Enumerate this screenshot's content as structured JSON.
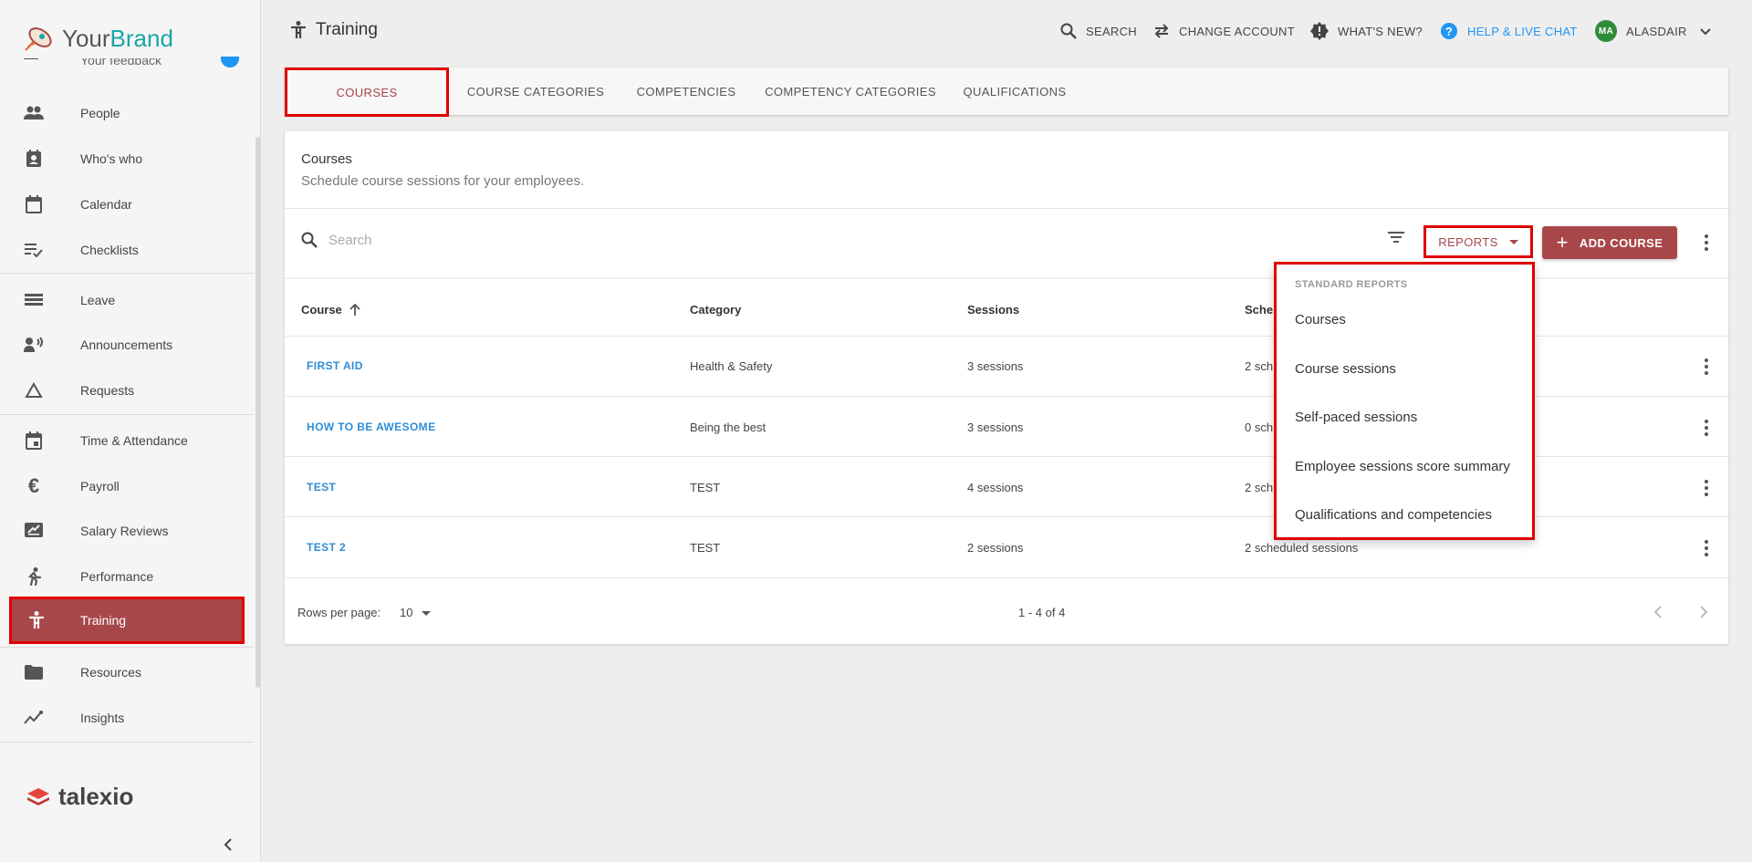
{
  "brand": {
    "name_part1": "Your",
    "name_part2": "Brand"
  },
  "sidebar": {
    "partial_item": "Your feedback",
    "items": [
      {
        "label": "People",
        "icon": "people-icon"
      },
      {
        "label": "Who's who",
        "icon": "contact-card-icon"
      },
      {
        "label": "Calendar",
        "icon": "calendar-icon"
      },
      {
        "label": "Checklists",
        "icon": "checklist-icon"
      },
      {
        "label": "Leave",
        "icon": "leave-icon"
      },
      {
        "label": "Announcements",
        "icon": "announcement-icon"
      },
      {
        "label": "Requests",
        "icon": "triangle-icon"
      },
      {
        "label": "Time & Attendance",
        "icon": "calendar-clock-icon"
      },
      {
        "label": "Payroll",
        "icon": "euro-icon"
      },
      {
        "label": "Salary Reviews",
        "icon": "salary-review-icon"
      },
      {
        "label": "Performance",
        "icon": "running-icon"
      },
      {
        "label": "Training",
        "icon": "person-icon"
      },
      {
        "label": "Resources",
        "icon": "folder-icon"
      },
      {
        "label": "Insights",
        "icon": "insights-icon"
      }
    ],
    "footer_brand": "talexio"
  },
  "header": {
    "title": "Training",
    "search": "SEARCH",
    "change_account": "CHANGE ACCOUNT",
    "whats_new": "WHAT'S NEW?",
    "help": "HELP & LIVE CHAT",
    "avatar_initials": "MA",
    "user": "ALASDAIR"
  },
  "tabs": [
    "COURSES",
    "COURSE CATEGORIES",
    "COMPETENCIES",
    "COMPETENCY CATEGORIES",
    "QUALIFICATIONS"
  ],
  "card": {
    "title": "Courses",
    "subtitle": "Schedule course sessions for your employees.",
    "search_placeholder": "Search",
    "reports_label": "REPORTS",
    "add_label": "ADD COURSE"
  },
  "table": {
    "headers": [
      "Course",
      "Category",
      "Sessions",
      "Sche"
    ],
    "rows": [
      {
        "course": "FIRST AID",
        "category": "Health & Safety",
        "sessions": "3 sessions",
        "scheduled": "2 sch"
      },
      {
        "course": "HOW TO BE AWESOME",
        "category": "Being the best",
        "sessions": "3 sessions",
        "scheduled": "0 sch"
      },
      {
        "course": "TEST",
        "category": "TEST",
        "sessions": "4 sessions",
        "scheduled": "2 sch"
      },
      {
        "course": "TEST 2",
        "category": "TEST",
        "sessions": "2 sessions",
        "scheduled": "2 scheduled sessions"
      }
    ]
  },
  "pagination": {
    "rows_per_page_label": "Rows per page:",
    "rows_per_page": "10",
    "range": "1 - 4 of 4"
  },
  "reports_menu": {
    "heading": "STANDARD REPORTS",
    "items": [
      "Courses",
      "Course sessions",
      "Self-paced sessions",
      "Employee sessions score summary",
      "Qualifications and competencies"
    ]
  },
  "colors": {
    "accent": "#a8474a",
    "link": "#2f8dd6",
    "help": "#2196f3",
    "highlight": "#e00000"
  }
}
